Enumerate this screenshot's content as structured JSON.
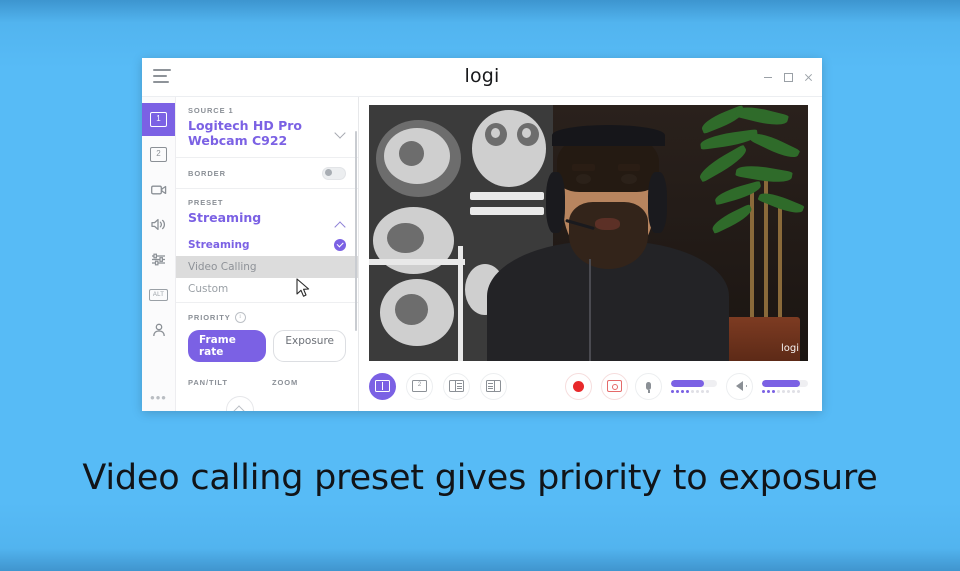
{
  "caption": "Video calling preset gives priority to exposure",
  "window": {
    "brand": "logi",
    "menu_icon": "hamburger-icon",
    "controls": {
      "minimize": "minimize-icon",
      "maximize": "maximize-icon",
      "close": "close-icon"
    }
  },
  "rail": {
    "items": [
      {
        "label": "1",
        "icon": "source-1-icon",
        "active": true
      },
      {
        "label": "2",
        "icon": "source-2-icon",
        "active": false
      },
      {
        "label": "",
        "icon": "camera-icon",
        "active": false
      },
      {
        "label": "",
        "icon": "speaker-icon",
        "active": false
      },
      {
        "label": "",
        "icon": "mixer-icon",
        "active": false
      },
      {
        "label": "ALT",
        "icon": "alt-key-icon",
        "active": false
      },
      {
        "label": "",
        "icon": "person-icon",
        "active": false
      }
    ],
    "more": "•••"
  },
  "panel": {
    "source": {
      "label": "SOURCE 1",
      "value": "Logitech HD Pro Webcam C922",
      "chevron": "chevron-down-icon"
    },
    "border": {
      "label": "BORDER",
      "toggle_state": "off"
    },
    "preset": {
      "label": "PRESET",
      "value": "Streaming",
      "chevron": "chevron-up-icon",
      "options": [
        {
          "label": "Streaming",
          "state": "selected"
        },
        {
          "label": "Video Calling",
          "state": "hover"
        },
        {
          "label": "Custom",
          "state": "normal"
        }
      ]
    },
    "priority": {
      "label": "PRIORITY",
      "info_icon": "info-icon",
      "options": [
        {
          "label": "Frame rate",
          "active": true
        },
        {
          "label": "Exposure",
          "active": false
        }
      ]
    },
    "controls": {
      "pan_tilt": "PAN/TILT",
      "zoom": "ZOOM"
    }
  },
  "video": {
    "watermark": "logi"
  },
  "toolbar": {
    "views": [
      {
        "name": "view-single",
        "label": "1",
        "active": true
      },
      {
        "name": "view-secondary",
        "label": "2",
        "active": false
      },
      {
        "name": "view-split-left",
        "label": "",
        "active": false
      },
      {
        "name": "view-split-right",
        "label": "",
        "active": false
      }
    ],
    "record": {
      "name": "record-button",
      "icon": "record-dot-icon"
    },
    "snapshot": {
      "name": "snapshot-button",
      "icon": "camera-icon"
    },
    "mic": {
      "icon": "microphone-icon",
      "level_percent": 72,
      "dots_on": 4,
      "dots_total": 8
    },
    "speaker": {
      "icon": "speaker-icon",
      "level_percent": 82,
      "dots_on": 3,
      "dots_total": 8
    }
  },
  "colors": {
    "background": "#57bbf6",
    "accent": "#7b61e4",
    "record": "#e8292b",
    "panel_bg": "#ffffff"
  }
}
